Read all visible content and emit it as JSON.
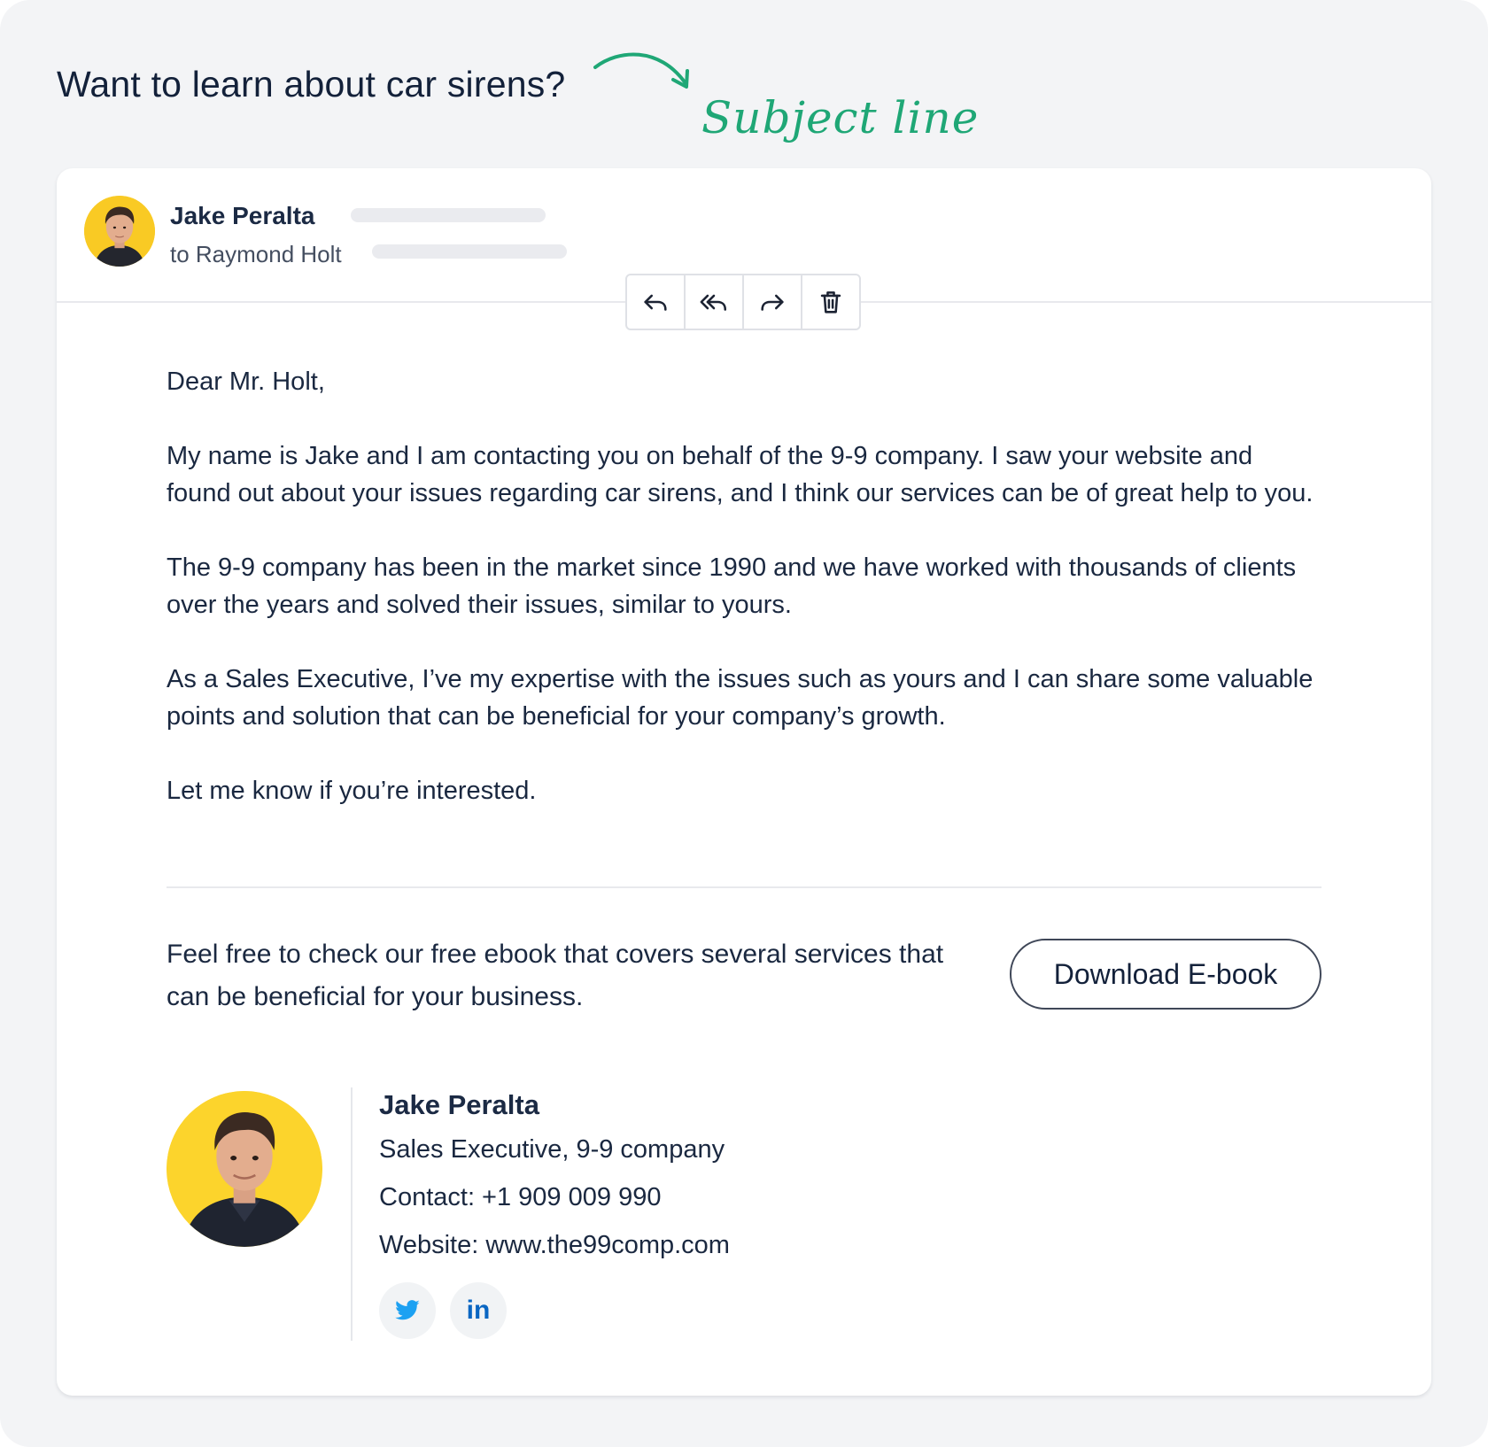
{
  "email": {
    "subject": "Want to learn about car sirens?",
    "annotation_label": "Subject line",
    "sender": {
      "name": "Jake Peralta",
      "recipient_line": "to Raymond Holt"
    },
    "toolbar": [
      {
        "icon": "reply-icon"
      },
      {
        "icon": "reply-all-icon"
      },
      {
        "icon": "forward-icon"
      },
      {
        "icon": "trash-icon"
      }
    ],
    "body": {
      "greeting": "Dear Mr. Holt,",
      "paragraphs": [
        "My name is Jake and I am contacting you on behalf of the 9-9 company. I saw your website and found out about your issues regarding car sirens, and I think our services can be of great help to you.",
        "The 9-9 company has been in the market since 1990 and we have worked with thousands of clients over the years and solved their issues, similar to yours.",
        "As a Sales Executive, I’ve my expertise with the issues such as yours and I can share some valuable points and solution that can be beneficial for your company’s growth.",
        "Let me know if you’re interested."
      ]
    },
    "cta": {
      "text": "Feel free to check our free ebook that covers several services that can be beneficial for your business.",
      "button_label": "Download E-book"
    },
    "signature": {
      "name": "Jake Peralta",
      "title": "Sales Executive, 9-9 company",
      "contact": "Contact: +1 909 009 990",
      "website": "Website: www.the99comp.com",
      "social": [
        {
          "icon": "twitter-icon",
          "color": "#1da1f2"
        },
        {
          "icon": "linkedin-icon",
          "label": "in",
          "color": "#0a66c2"
        }
      ]
    }
  },
  "colors": {
    "background": "#f3f4f6",
    "card": "#ffffff",
    "text": "#15223a",
    "annotation": "#1fa776",
    "avatar_bg": "#fcd42c"
  }
}
